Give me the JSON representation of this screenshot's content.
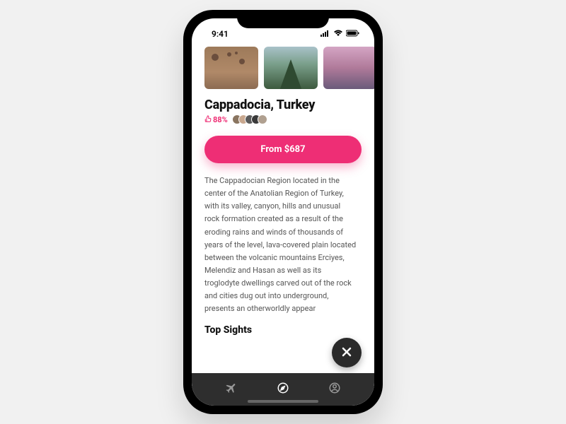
{
  "status": {
    "time": "9:41"
  },
  "destination": {
    "title": "Cappadocia, Turkey",
    "rating_percent": "88%",
    "cta_label": "From $687",
    "description": "The Cappadocian Region located in the center of the Anatolian Region of Turkey, with its valley, canyon, hills and unusual rock formation created as a result of the eroding rains and winds of thousands of years of the level, lava-covered plain located between the volcanic mountains Erciyes, Melendiz and Hasan as well as its troglodyte dwellings carved out of the rock and cities dug out into underground, presents an otherworldly appear"
  },
  "sections": {
    "top_sights": "Top Sights"
  },
  "gallery": {
    "items": [
      "balloons-cappadocia",
      "mountain-ruins",
      "coast-sunset"
    ]
  },
  "friends_count": 5
}
